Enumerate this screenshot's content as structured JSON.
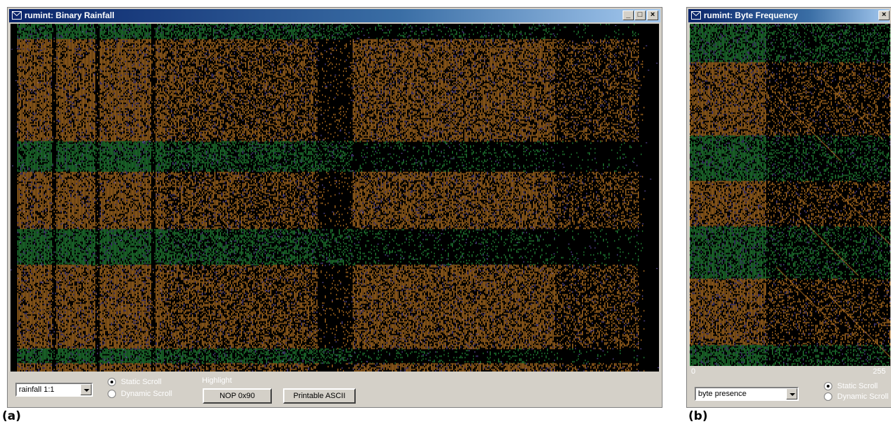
{
  "window_a": {
    "title": "rumint: Binary Rainfall",
    "title_buttons": {
      "minimize": "_",
      "maximize": "□",
      "close": "×"
    },
    "view_select": "rainfall 1:1",
    "scroll_options": [
      {
        "label": "Static Scroll",
        "selected": true
      },
      {
        "label": "Dynamic Scroll",
        "selected": false
      }
    ],
    "highlight_label": "Highlight",
    "buttons": {
      "nop": "NOP 0x90",
      "ascii": "Printable ASCII"
    }
  },
  "window_b": {
    "title": "rumint: Byte Frequency",
    "title_buttons": {
      "close": "×"
    },
    "axis_min": "0",
    "axis_max": "255",
    "view_select": "byte presence",
    "scroll_options": [
      {
        "label": "Static Scroll",
        "selected": true
      },
      {
        "label": "Dynamic Scroll",
        "selected": false
      }
    ]
  },
  "captions": {
    "a": "(a)",
    "b": "(b)"
  },
  "colors": {
    "orange": "#f0982f",
    "green": "#2fb24a",
    "purple": "#6b58b8",
    "background": "#000000"
  },
  "icons": {
    "window_icon": "envelope-icon",
    "dropdown_icon": "chevron-down-icon"
  }
}
